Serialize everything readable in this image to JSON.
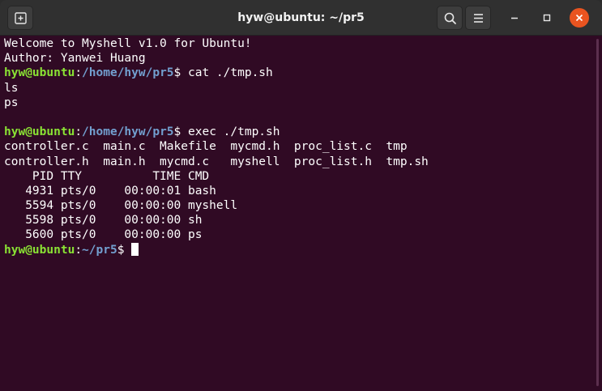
{
  "window": {
    "title": "hyw@ubuntu: ~/pr5"
  },
  "icons": {
    "new_tab": "new-tab-icon",
    "search": "search-icon",
    "menu": "hamburger-menu-icon",
    "minimize": "minimize-icon",
    "maximize": "maximize-icon",
    "close": "close-icon"
  },
  "colors": {
    "terminal_bg": "#300a24",
    "prompt_user": "#8ae234",
    "prompt_path": "#729fcf",
    "close_button": "#e95420"
  },
  "terminal": {
    "lines": [
      {
        "type": "text",
        "text": "Welcome to Myshell v1.0 for Ubuntu!"
      },
      {
        "type": "text",
        "text": "Author: Yanwei Huang"
      },
      {
        "type": "prompt",
        "user": "hyw@ubuntu",
        "sep": ":",
        "path": "/home/hyw/pr5",
        "dollar": "$",
        "cmd": " cat ./tmp.sh"
      },
      {
        "type": "text",
        "text": "ls"
      },
      {
        "type": "text",
        "text": "ps"
      },
      {
        "type": "text",
        "text": ""
      },
      {
        "type": "prompt",
        "user": "hyw@ubuntu",
        "sep": ":",
        "path": "/home/hyw/pr5",
        "dollar": "$",
        "cmd": " exec ./tmp.sh"
      },
      {
        "type": "text",
        "text": "controller.c  main.c  Makefile  mycmd.h  proc_list.c  tmp"
      },
      {
        "type": "text",
        "text": "controller.h  main.h  mycmd.c   myshell  proc_list.h  tmp.sh"
      },
      {
        "type": "text",
        "text": "    PID TTY          TIME CMD"
      },
      {
        "type": "text",
        "text": "   4931 pts/0    00:00:01 bash"
      },
      {
        "type": "text",
        "text": "   5594 pts/0    00:00:00 myshell"
      },
      {
        "type": "text",
        "text": "   5598 pts/0    00:00:00 sh"
      },
      {
        "type": "text",
        "text": "   5600 pts/0    00:00:00 ps"
      },
      {
        "type": "prompt",
        "user": "hyw@ubuntu",
        "sep": ":",
        "path": "~/pr5",
        "dollar": "$",
        "cmd": " ",
        "cursor": true
      }
    ]
  }
}
